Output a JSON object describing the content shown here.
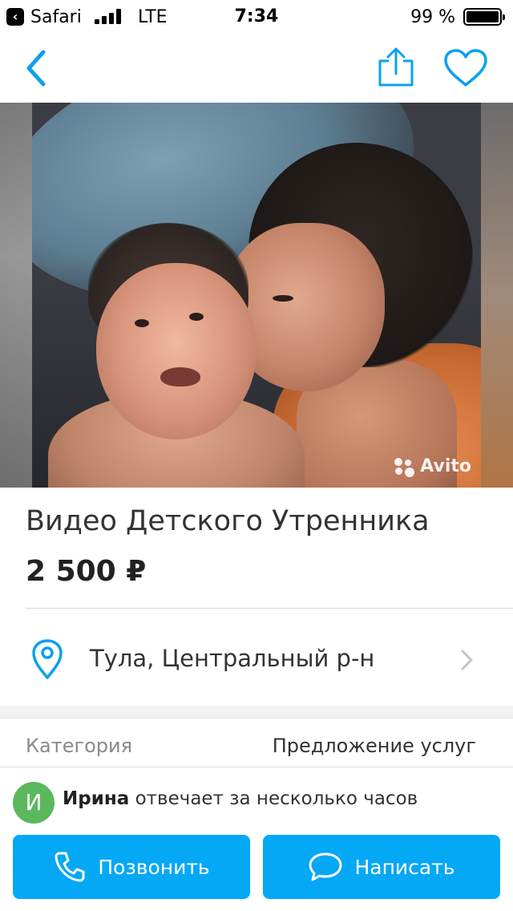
{
  "status_bar": {
    "back_app": "Safari",
    "network": "LTE",
    "time": "7:34",
    "battery_pct": "99 %",
    "battery_level": 0.99
  },
  "nav": {
    "back_icon": "chevron-left-icon",
    "share_icon": "share-icon",
    "favorite_icon": "heart-icon",
    "accent_color": "#0aa0f0"
  },
  "photo": {
    "watermark": "Avito"
  },
  "listing": {
    "title": "Видео Детского Утренника",
    "price": "2 500 ₽",
    "location": "Тула, Центральный р-н",
    "category_label": "Категория",
    "category_value": "Предложение услуг"
  },
  "seller": {
    "avatar_letter": "И",
    "name": "Ирина",
    "response": "отвечает за несколько часов",
    "avatar_color": "#5cb85c"
  },
  "actions": {
    "call_label": "Позвонить",
    "message_label": "Написать",
    "button_color": "#04a8f5"
  }
}
